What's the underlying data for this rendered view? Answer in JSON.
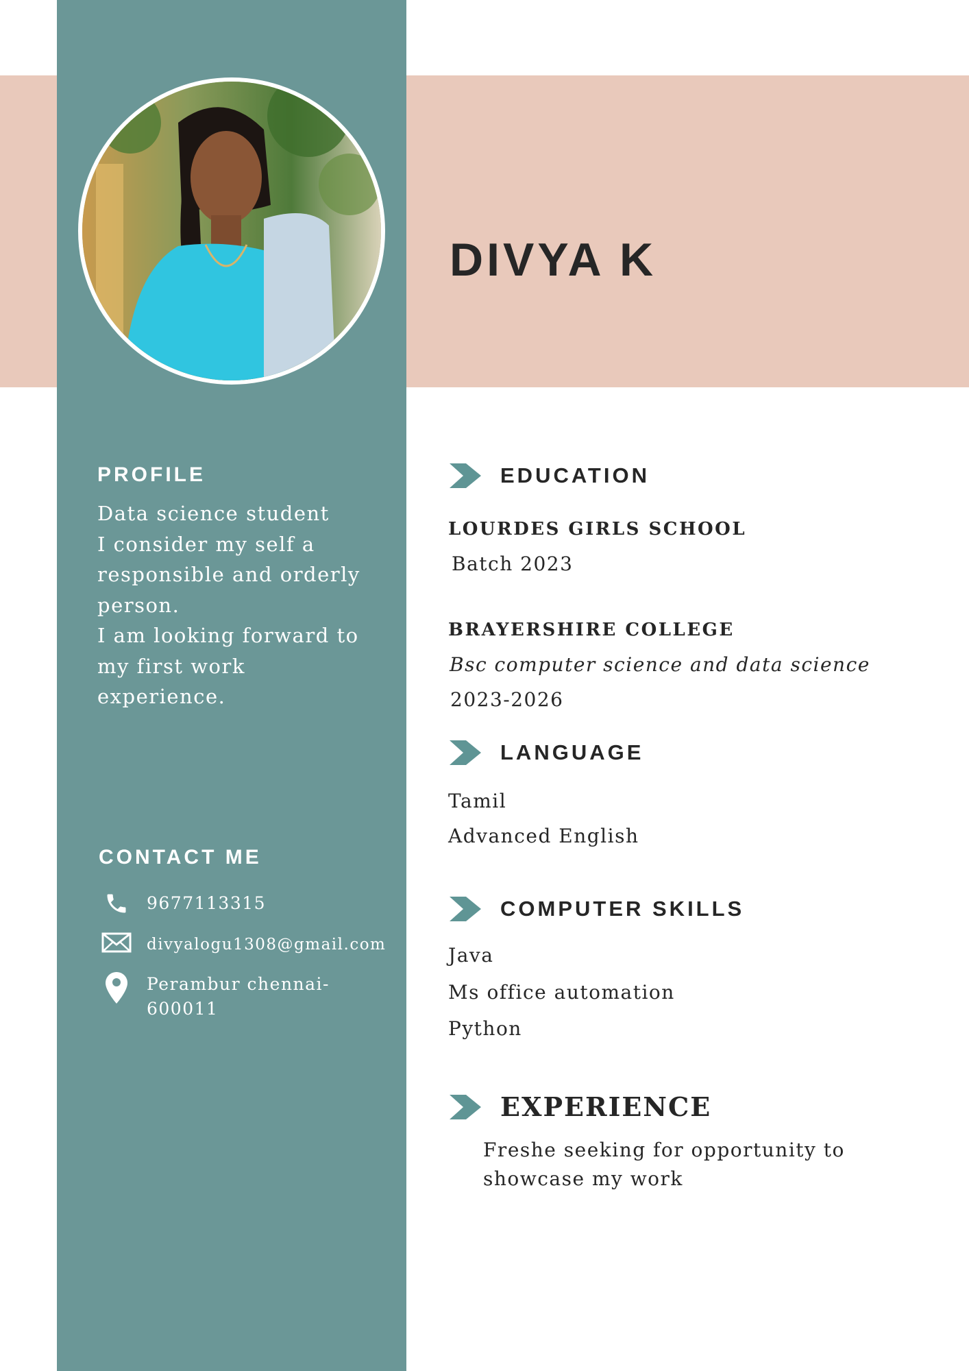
{
  "name": "DIVYA K",
  "colors": {
    "sidebar": "#6b9797",
    "band": "#e9c9bb",
    "text": "#262626",
    "accent": "#5f9595"
  },
  "profile": {
    "heading": "PROFILE",
    "lines": [
      "Data science student",
      "I consider my self a",
      "responsible and orderly",
      "person.",
      "I am looking forward to",
      "my first work",
      "experience."
    ]
  },
  "contact": {
    "heading": "CONTACT ME",
    "phone": "9677113315",
    "email": "divyalogu1308@gmail.com",
    "address_line1": "Perambur chennai-",
    "address_line2": "600011",
    "icons": [
      "phone-icon",
      "mail-icon",
      "location-pin-icon"
    ]
  },
  "education": {
    "heading": "EDUCATION",
    "school_name": "LOURDES GIRLS SCHOOL",
    "school_batch": "Batch 2023",
    "college_name": "BRAYERSHIRE COLLEGE",
    "college_course": "Bsc computer science and data science",
    "college_years": "2023-2026"
  },
  "language": {
    "heading": "LANGUAGE",
    "items": [
      "Tamil",
      "Advanced English"
    ]
  },
  "skills": {
    "heading": "COMPUTER SKILLS",
    "items": [
      "Java",
      "Ms office automation",
      "Python"
    ]
  },
  "experience": {
    "heading": "EXPERIENCE",
    "line1": "Freshe seeking for opportunity to",
    "line2": "showcase my work"
  }
}
